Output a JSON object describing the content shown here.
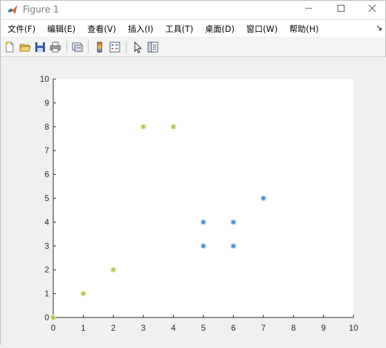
{
  "window": {
    "title": "Figure 1"
  },
  "menu": {
    "items": [
      {
        "label": "文件(F)"
      },
      {
        "label": "编辑(E)"
      },
      {
        "label": "查看(V)"
      },
      {
        "label": "插入(I)"
      },
      {
        "label": "工具(T)"
      },
      {
        "label": "桌面(D)"
      },
      {
        "label": "窗口(W)"
      },
      {
        "label": "帮助(H)"
      }
    ],
    "overflow_label": "↘"
  },
  "toolbar": {
    "icons": [
      "new-figure-icon",
      "open-file-icon",
      "save-icon",
      "print-icon",
      "link-plot-icon",
      "colorbar-icon",
      "legend-icon",
      "select-cursor-icon",
      "property-editor-icon"
    ]
  },
  "colors": {
    "series_a": "#b5b532",
    "series_b": "#2f7fd8",
    "axes_bg": "#ffffff",
    "figure_bg": "#f0f0f0"
  },
  "chart_data": {
    "type": "scatter",
    "marker": "*",
    "xlim": [
      0,
      10
    ],
    "ylim": [
      0,
      10
    ],
    "xticks": [
      0,
      1,
      2,
      3,
      4,
      5,
      6,
      7,
      8,
      9,
      10
    ],
    "yticks": [
      0,
      1,
      2,
      3,
      4,
      5,
      6,
      7,
      8,
      9,
      10
    ],
    "grid": false,
    "series": [
      {
        "color": "#b5b532",
        "points": [
          [
            0,
            0
          ],
          [
            1,
            1
          ],
          [
            2,
            2
          ],
          [
            3,
            8
          ],
          [
            4,
            8
          ]
        ]
      },
      {
        "color": "#2f7fd8",
        "points": [
          [
            5,
            3
          ],
          [
            5,
            4
          ],
          [
            6,
            3
          ],
          [
            6,
            4
          ],
          [
            7,
            5
          ]
        ]
      }
    ]
  }
}
